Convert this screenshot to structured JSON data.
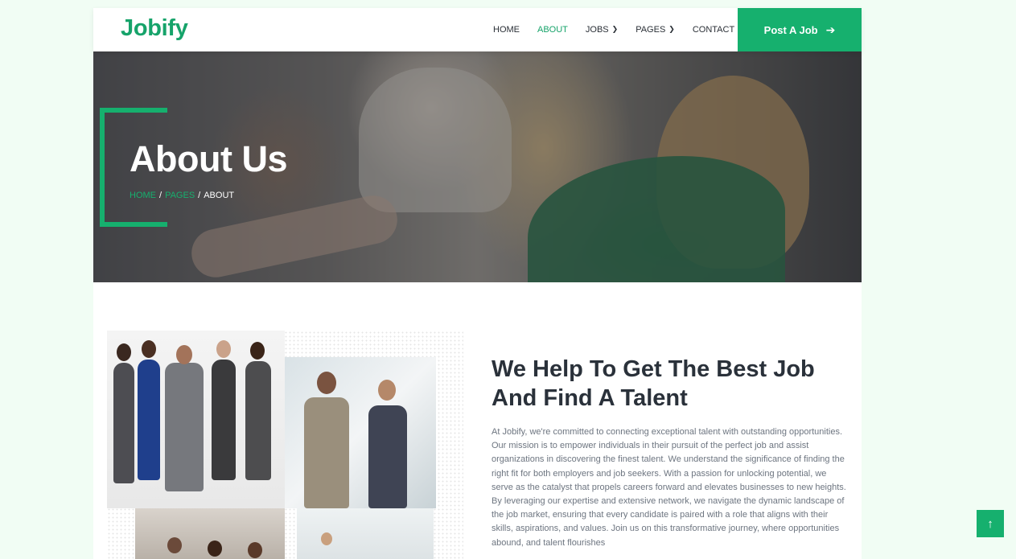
{
  "brand": {
    "name": "Jobify"
  },
  "nav": {
    "items": [
      {
        "label": "HOME",
        "active": false,
        "dropdown": false
      },
      {
        "label": "ABOUT",
        "active": true,
        "dropdown": false
      },
      {
        "label": "JOBS",
        "active": false,
        "dropdown": true
      },
      {
        "label": "PAGES",
        "active": false,
        "dropdown": true
      },
      {
        "label": "CONTACT",
        "active": false,
        "dropdown": false
      }
    ],
    "cta_label": "Post A Job",
    "cta_icon": "arrow-right-icon"
  },
  "hero": {
    "title": "About Us",
    "breadcrumb": {
      "home": "HOME",
      "pages": "PAGES",
      "current": "ABOUT",
      "separator": "/"
    }
  },
  "about": {
    "heading": "We Help To Get The Best Job And Find A Talent",
    "body": "At Jobify, we're committed to connecting exceptional talent with outstanding opportunities. Our mission is to empower individuals in their pursuit of the perfect job and assist organizations in discovering the finest talent. We understand the significance of finding the right fit for both employers and job seekers. With a passion for unlocking potential, we serve as the catalyst that propels careers forward and elevates businesses to new heights. By leveraging our expertise and extensive network, we navigate the dynamic landscape of the job market, ensuring that every candidate is paired with a role that aligns with their skills, aspirations, and values. Join us on this transformative journey, where opportunities abound, and talent flourishes"
  },
  "scroll_top": {
    "icon": "arrow-up-icon",
    "glyph": "↑"
  },
  "colors": {
    "accent": "#16b06e",
    "brand": "#16a36a",
    "page_bg": "#f1fdf4",
    "heading": "#2a313a"
  }
}
